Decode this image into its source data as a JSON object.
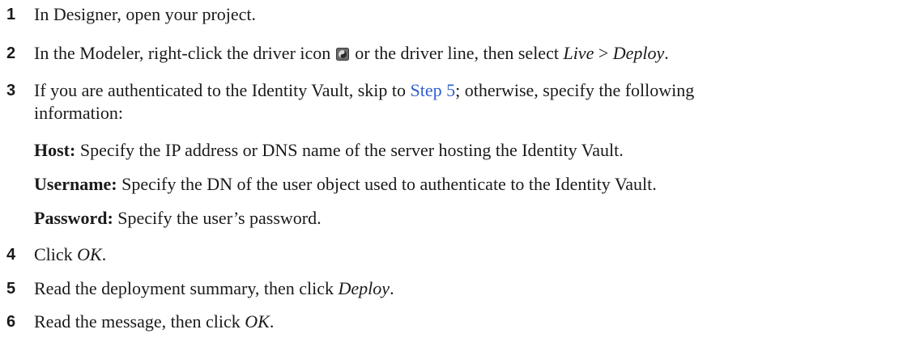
{
  "steps": [
    {
      "number": "1",
      "text": "In Designer, open your project."
    },
    {
      "number": "2",
      "text_before": "In the Modeler, right-click the driver icon",
      "icon": "driver-icon",
      "text_mid": "or the driver line, then select",
      "menu_path_1": "Live",
      "separator": ">",
      "menu_path_2": "Deploy",
      "end": "."
    },
    {
      "number": "3",
      "text_before": "If you are authenticated to the Identity Vault, skip to",
      "link": "Step 5",
      "text_after": "; otherwise, specify the following",
      "text_line2": "information:",
      "fields": [
        {
          "label": "Host:",
          "desc": "Specify the IP address or DNS name of the server hosting the Identity Vault."
        },
        {
          "label": "Username:",
          "desc": "Specify the DN of the user object used to authenticate to the Identity Vault."
        },
        {
          "label": "Password:",
          "desc": "Specify the user’s password."
        }
      ]
    },
    {
      "number": "4",
      "text_before": "Click",
      "emph": "OK",
      "end": "."
    },
    {
      "number": "5",
      "text_before": "Read the deployment summary, then click",
      "emph": "Deploy",
      "end": "."
    },
    {
      "number": "6",
      "text_before": "Read the message, then click",
      "emph": "OK",
      "end": "."
    }
  ]
}
